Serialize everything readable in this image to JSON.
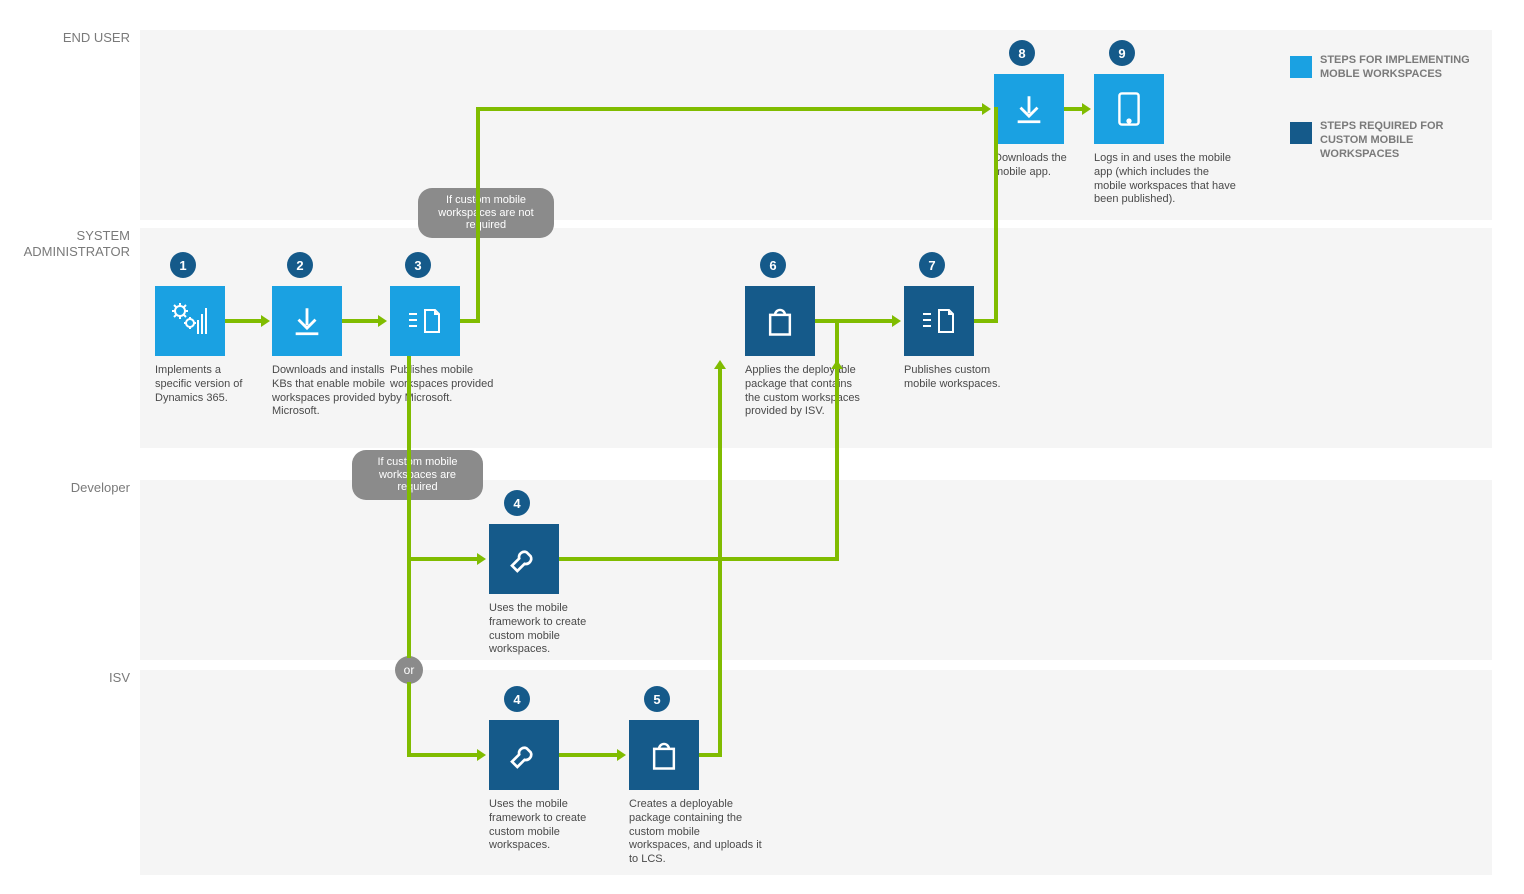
{
  "lanes": {
    "end_user": "END USER",
    "sysadmin_l1": "SYSTEM",
    "sysadmin_l2": "ADMINISTRATOR",
    "developer": "Developer",
    "isv": "ISV"
  },
  "steps": {
    "s1": {
      "num": "1",
      "desc": "Implements a specific version of Dynamics 365."
    },
    "s2": {
      "num": "2",
      "desc": "Downloads and installs KBs that enable mobile workspaces provided by Microsoft."
    },
    "s3": {
      "num": "3",
      "desc": "Publishes mobile workspaces provided by Microsoft."
    },
    "s4a": {
      "num": "4",
      "desc": "Uses the mobile framework to create custom mobile workspaces."
    },
    "s4b": {
      "num": "4",
      "desc": "Uses the mobile framework to create custom mobile workspaces."
    },
    "s5": {
      "num": "5",
      "desc": "Creates a deployable package containing the custom mobile workspaces, and uploads it to LCS."
    },
    "s6": {
      "num": "6",
      "desc": "Applies the deployable package that contains the custom workspaces provided by ISV."
    },
    "s7": {
      "num": "7",
      "desc": "Publishes custom mobile workspaces."
    },
    "s8": {
      "num": "8",
      "desc": "Downloads the mobile app."
    },
    "s9": {
      "num": "9",
      "desc": "Logs in and uses the mobile app (which includes the mobile workspaces that have been published)."
    }
  },
  "decisions": {
    "not_required": "If custom mobile workspaces are not required",
    "required": "If custom mobile workspaces are required",
    "or": "or"
  },
  "legend": {
    "impl": "STEPS FOR IMPLEMENTING MOBLE WORKSPACES",
    "custom": "STEPS REQUIRED FOR CUSTOM MOBILE WORKSPACES"
  },
  "colors": {
    "light": "#1aa1e2",
    "dark": "#155a8a",
    "green": "#80bc00",
    "grey": "#8b8b8b"
  }
}
